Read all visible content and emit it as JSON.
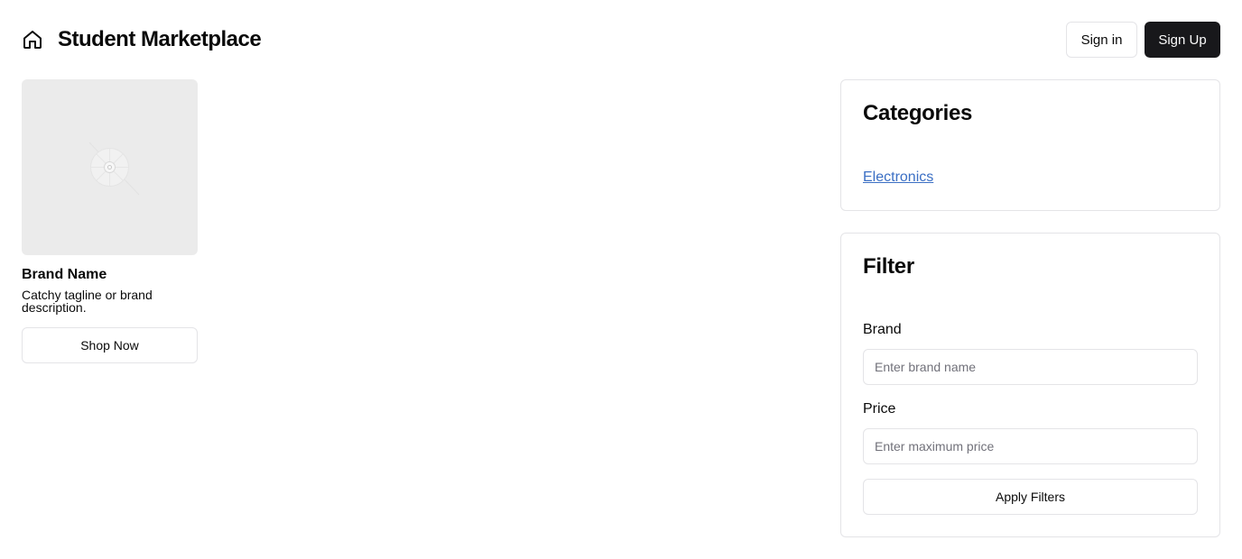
{
  "header": {
    "home_icon": "home-icon",
    "title": "Student Marketplace",
    "sign_in_label": "Sign in",
    "sign_up_label": "Sign Up"
  },
  "product": {
    "image_icon": "image-placeholder-icon",
    "brand_name": "Brand Name",
    "tagline": "Catchy tagline or brand description.",
    "shop_label": "Shop Now"
  },
  "categories": {
    "title": "Categories",
    "items": [
      {
        "label": "Electronics"
      }
    ]
  },
  "filter": {
    "title": "Filter",
    "brand_label": "Brand",
    "brand_placeholder": "Enter brand name",
    "brand_value": "",
    "price_label": "Price",
    "price_placeholder": "Enter maximum price",
    "price_value": "",
    "apply_label": "Apply Filters"
  },
  "colors": {
    "primary_button": "#18181b",
    "link": "#3b6fc4",
    "border": "#e4e4e7",
    "image_bg": "#ebebeb"
  }
}
